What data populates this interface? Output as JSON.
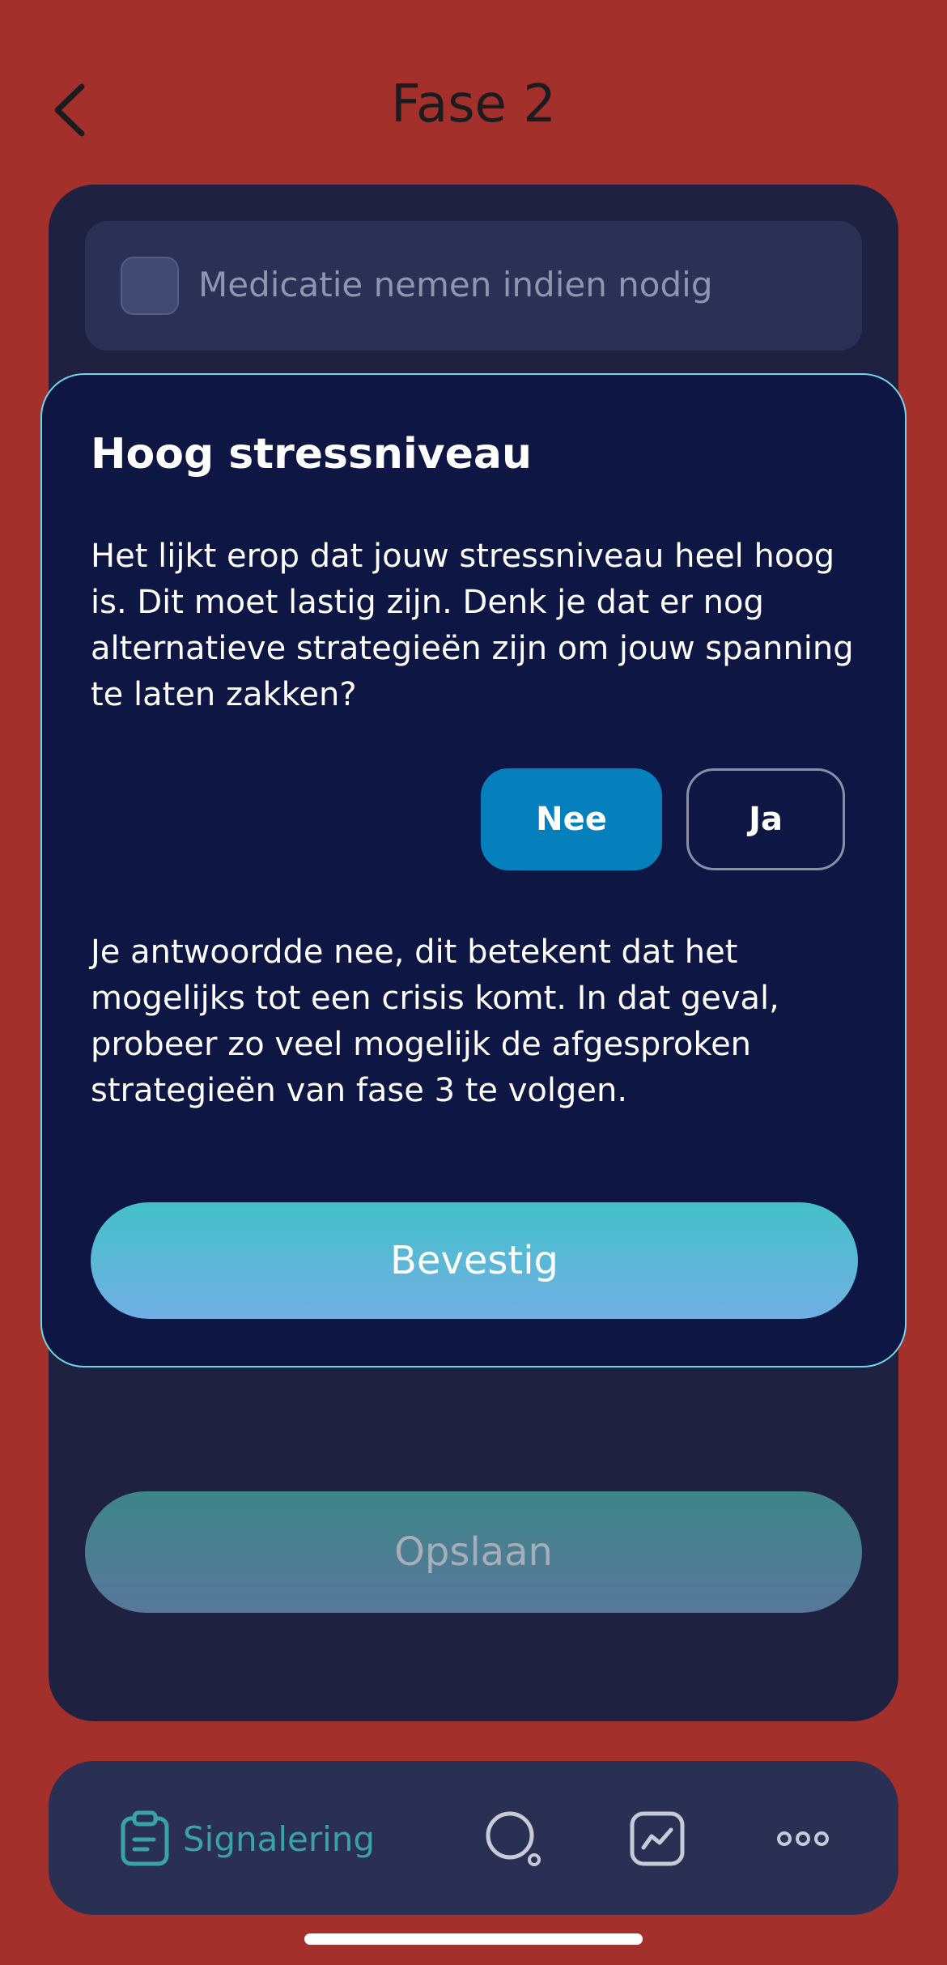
{
  "header": {
    "title": "Fase 2"
  },
  "checklist": {
    "item_label": "Medicatie nemen indien nodig"
  },
  "dialog": {
    "title": "Hoog stressniveau",
    "question": "Het lijkt erop dat jouw stressniveau heel hoog is. Dit moet lastig zijn. Denk je dat er nog alternatieve strategieën zijn om jouw spanning te laten zakken?",
    "no_label": "Nee",
    "yes_label": "Ja",
    "selected": "Nee",
    "answer_text": "Je antwoordde nee, dit betekent dat het mogelijks tot een crisis komt. In dat geval, probeer zo veel mogelijk de afgesproken strategieën van fase 3 te volgen.",
    "confirm_label": "Bevestig"
  },
  "footer": {
    "save_label": "Opslaan"
  },
  "tabbar": {
    "active_label": "Signalering",
    "icons": [
      "clipboard-icon",
      "search-icon",
      "chart-icon",
      "more-icon"
    ]
  },
  "colors": {
    "background": "#a4302c",
    "card": "#1f2140",
    "dialog": "#0e1643",
    "accent": "#0580bd",
    "teal": "#3aa3a6"
  }
}
